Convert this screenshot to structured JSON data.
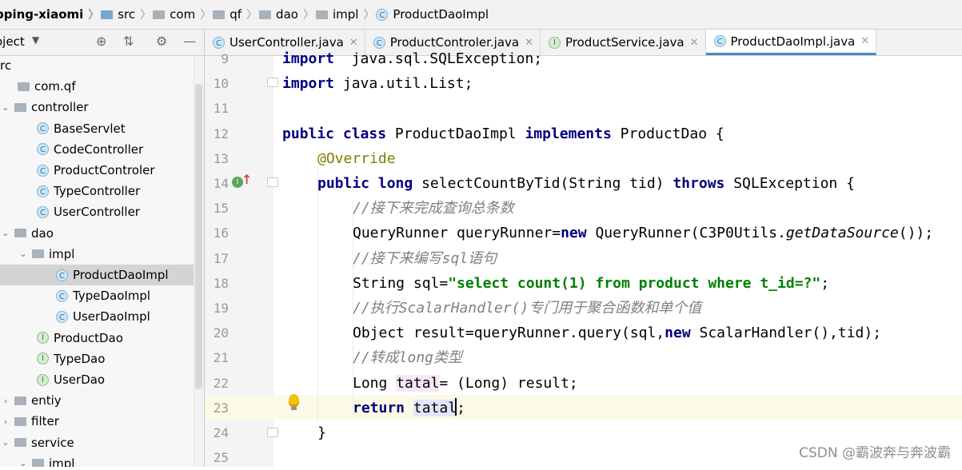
{
  "breadcrumb": [
    "pping-xiaomi",
    "src",
    "com",
    "qf",
    "dao",
    "impl",
    "ProductDaoImpl"
  ],
  "project_panel": {
    "title": "oject"
  },
  "tree": [
    {
      "label": "rc",
      "depth": 0,
      "kind": "none",
      "arrow": ""
    },
    {
      "label": "com.qf",
      "depth": 0,
      "kind": "package",
      "arrow": ""
    },
    {
      "label": "controller",
      "depth": 0,
      "kind": "package",
      "arrow": "expanded"
    },
    {
      "label": "BaseServlet",
      "depth": 1,
      "kind": "class",
      "arrow": ""
    },
    {
      "label": "CodeController",
      "depth": 1,
      "kind": "class",
      "arrow": ""
    },
    {
      "label": "ProductControler",
      "depth": 1,
      "kind": "class",
      "arrow": ""
    },
    {
      "label": "TypeController",
      "depth": 1,
      "kind": "class",
      "arrow": ""
    },
    {
      "label": "UserController",
      "depth": 1,
      "kind": "class",
      "arrow": ""
    },
    {
      "label": "dao",
      "depth": 0,
      "kind": "package",
      "arrow": "expanded"
    },
    {
      "label": "impl",
      "depth": 1,
      "kind": "package",
      "arrow": "expanded"
    },
    {
      "label": "ProductDaoImpl",
      "depth": 2,
      "kind": "class",
      "arrow": "",
      "selected": true
    },
    {
      "label": "TypeDaoImpl",
      "depth": 2,
      "kind": "class",
      "arrow": ""
    },
    {
      "label": "UserDaoImpl",
      "depth": 2,
      "kind": "class",
      "arrow": ""
    },
    {
      "label": "ProductDao",
      "depth": 1,
      "kind": "interface",
      "arrow": ""
    },
    {
      "label": "TypeDao",
      "depth": 1,
      "kind": "interface",
      "arrow": ""
    },
    {
      "label": "UserDao",
      "depth": 1,
      "kind": "interface",
      "arrow": ""
    },
    {
      "label": "entiy",
      "depth": 0,
      "kind": "package",
      "arrow": "collapsed"
    },
    {
      "label": "filter",
      "depth": 0,
      "kind": "package",
      "arrow": "collapsed"
    },
    {
      "label": "service",
      "depth": 0,
      "kind": "package",
      "arrow": "expanded"
    },
    {
      "label": "impl",
      "depth": 1,
      "kind": "package",
      "arrow": "expanded"
    }
  ],
  "tabs": [
    {
      "label": "UserController.java",
      "icon": "C",
      "active": false
    },
    {
      "label": "ProductControler.java",
      "icon": "C",
      "active": false
    },
    {
      "label": "ProductService.java",
      "icon": "I",
      "active": false
    },
    {
      "label": "ProductDaoImpl.java",
      "icon": "C",
      "active": true
    }
  ],
  "code": [
    {
      "n": "9",
      "indent": 0,
      "tokens": [
        [
          "kw0",
          "import"
        ],
        [
          "",
          "  java.sql.SQLException;"
        ]
      ]
    },
    {
      "n": "10",
      "indent": 0,
      "tokens": [
        [
          "kw0",
          "import"
        ],
        [
          "",
          " java.util.List;"
        ]
      ]
    },
    {
      "n": "11",
      "indent": 0,
      "tokens": []
    },
    {
      "n": "12",
      "indent": 0,
      "tokens": [
        [
          "kw",
          "public"
        ],
        [
          "",
          " "
        ],
        [
          "kw",
          "class"
        ],
        [
          "",
          " ProductDaoImpl "
        ],
        [
          "kw",
          "implements"
        ],
        [
          "",
          " ProductDao {"
        ]
      ]
    },
    {
      "n": "13",
      "indent": 1,
      "tokens": [
        [
          "ann",
          "@Override"
        ]
      ]
    },
    {
      "n": "14",
      "indent": 1,
      "tokens": [
        [
          "kw",
          "public"
        ],
        [
          "",
          " "
        ],
        [
          "kw",
          "long"
        ],
        [
          "",
          " selectCountByTid(String tid) "
        ],
        [
          "kw",
          "throws"
        ],
        [
          "",
          " SQLException {"
        ]
      ]
    },
    {
      "n": "15",
      "indent": 2,
      "tokens": [
        [
          "cmt",
          "//接下来完成查询总条数"
        ]
      ]
    },
    {
      "n": "16",
      "indent": 2,
      "tokens": [
        [
          "",
          "QueryRunner queryRunner="
        ],
        [
          "kw",
          "new"
        ],
        [
          "",
          " QueryRunner(C3P0Utils."
        ],
        [
          "ital",
          "getDataSource"
        ],
        [
          "",
          "());"
        ]
      ]
    },
    {
      "n": "17",
      "indent": 2,
      "tokens": [
        [
          "cmt",
          "//接下来编写sql语句"
        ]
      ]
    },
    {
      "n": "18",
      "indent": 2,
      "tokens": [
        [
          "",
          "String sql="
        ],
        [
          "str",
          "\"select count(1) from product where t_id=?\""
        ],
        [
          "",
          ";"
        ]
      ]
    },
    {
      "n": "19",
      "indent": 2,
      "tokens": [
        [
          "cmt",
          "//执行ScalarHandler()专门用于聚合函数和单个值"
        ]
      ]
    },
    {
      "n": "20",
      "indent": 2,
      "tokens": [
        [
          "",
          "Object result=queryRunner.query(sql,"
        ],
        [
          "kw",
          "new"
        ],
        [
          "",
          " ScalarHandler(),tid);"
        ]
      ]
    },
    {
      "n": "21",
      "indent": 2,
      "tokens": [
        [
          "cmt",
          "//转成long类型"
        ]
      ]
    },
    {
      "n": "22",
      "indent": 2,
      "tokens": [
        [
          "",
          "Long "
        ],
        [
          "var-hl",
          "tatal"
        ],
        [
          "",
          "= (Long) result;"
        ]
      ]
    },
    {
      "n": "23",
      "indent": 2,
      "tokens": [
        [
          "kw",
          "return"
        ],
        [
          "",
          " "
        ],
        [
          "var-hl2",
          "tatal"
        ],
        [
          "",
          ";"
        ]
      ]
    },
    {
      "n": "24",
      "indent": 1,
      "tokens": [
        [
          "",
          "}"
        ]
      ]
    },
    {
      "n": "25",
      "indent": 0,
      "tokens": []
    }
  ],
  "watermark": "CSDN @霸波奔与奔波霸"
}
